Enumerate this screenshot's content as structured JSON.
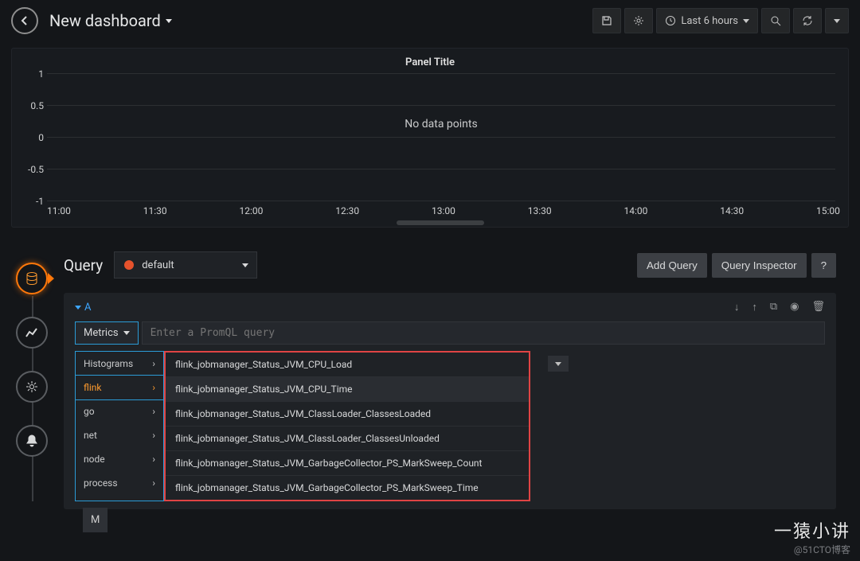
{
  "header": {
    "title": "New dashboard",
    "time_range": "Last 6 hours"
  },
  "panel": {
    "title": "Panel Title",
    "no_data": "No data points"
  },
  "chart_data": {
    "type": "line",
    "title": "Panel Title",
    "x": [
      "11:00",
      "11:30",
      "12:00",
      "12:30",
      "13:00",
      "13:30",
      "14:00",
      "14:30",
      "15:00"
    ],
    "series": [],
    "ylim": [
      -1.0,
      1.0
    ],
    "yticks": [
      -1.0,
      -0.5,
      0,
      0.5,
      1.0
    ],
    "xlabel": "",
    "ylabel": ""
  },
  "query": {
    "section_label": "Query",
    "datasource": "default",
    "add_query": "Add Query",
    "inspector": "Query Inspector",
    "help": "?"
  },
  "row": {
    "ref": "A",
    "metrics_btn": "Metrics",
    "placeholder": "Enter a PromQL query",
    "min_step_partial": "M"
  },
  "categories": [
    {
      "name": "Histograms",
      "selected": false
    },
    {
      "name": "flink",
      "selected": true
    },
    {
      "name": "go",
      "selected": false
    },
    {
      "name": "net",
      "selected": false
    },
    {
      "name": "node",
      "selected": false
    },
    {
      "name": "process",
      "selected": false
    }
  ],
  "metrics": [
    {
      "name": "flink_jobmanager_Status_JVM_CPU_Load",
      "hover": false
    },
    {
      "name": "flink_jobmanager_Status_JVM_CPU_Time",
      "hover": true
    },
    {
      "name": "flink_jobmanager_Status_JVM_ClassLoader_ClassesLoaded",
      "hover": false
    },
    {
      "name": "flink_jobmanager_Status_JVM_ClassLoader_ClassesUnloaded",
      "hover": false
    },
    {
      "name": "flink_jobmanager_Status_JVM_GarbageCollector_PS_MarkSweep_Count",
      "hover": false
    },
    {
      "name": "flink_jobmanager_Status_JVM_GarbageCollector_PS_MarkSweep_Time",
      "hover": false
    }
  ],
  "watermark": {
    "main": "一猿小讲",
    "sub": "@51CTO博客"
  }
}
